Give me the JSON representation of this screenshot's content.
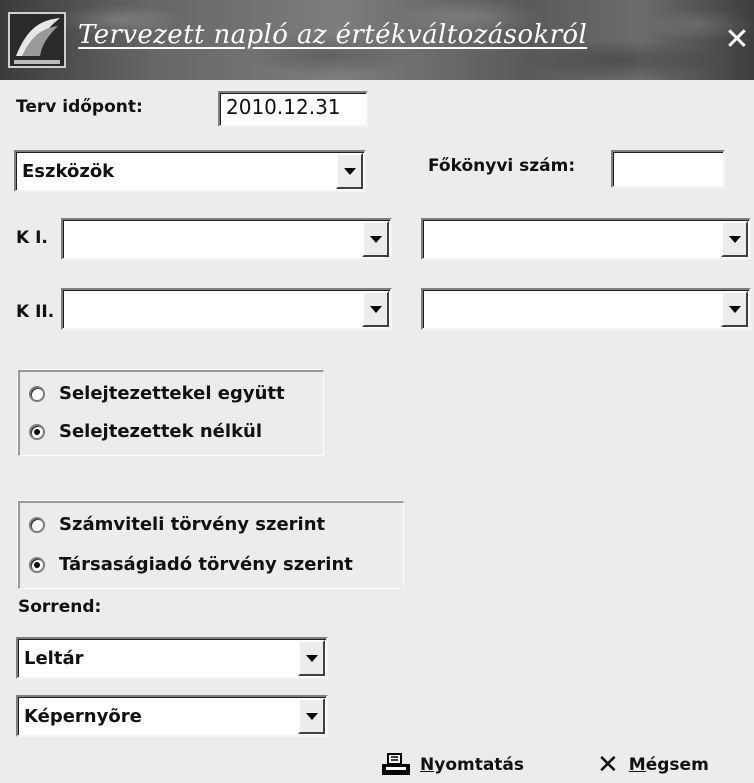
{
  "window": {
    "title": "Tervezett napló az értékváltozásokról",
    "close_icon": "close-icon",
    "logo_icon": "app-logo-icon"
  },
  "plan_date": {
    "label": "Terv időpont:",
    "value": "2010.12.31"
  },
  "category": {
    "value": "Eszközök",
    "options_visible": [
      "Eszközök"
    ]
  },
  "ledger": {
    "label": "Főkönyvi szám:",
    "value": ""
  },
  "k1": {
    "label": "K I.",
    "left_value": "",
    "right_value": ""
  },
  "k2": {
    "label": "K II.",
    "left_value": "",
    "right_value": ""
  },
  "scrapped_group": {
    "options": [
      {
        "label": "Selejtezettekel együtt",
        "checked": false
      },
      {
        "label": "Selejtezettek nélkül",
        "checked": true
      }
    ]
  },
  "law_group": {
    "options": [
      {
        "label": "Számviteli törvény szerint",
        "checked": false
      },
      {
        "label": "Társaságiadó törvény szerint",
        "checked": true
      }
    ]
  },
  "order": {
    "label": "Sorrend:",
    "value": "Leltár"
  },
  "output": {
    "value": "Képernyõre"
  },
  "actions": {
    "print": {
      "mnemonic": "N",
      "rest": "yomtatás",
      "icon": "printer-icon"
    },
    "cancel": {
      "mnemonic": "M",
      "rest": "égsem",
      "icon": "x-icon"
    }
  },
  "colors": {
    "background": "#ececec",
    "titlebar": "#666666"
  }
}
